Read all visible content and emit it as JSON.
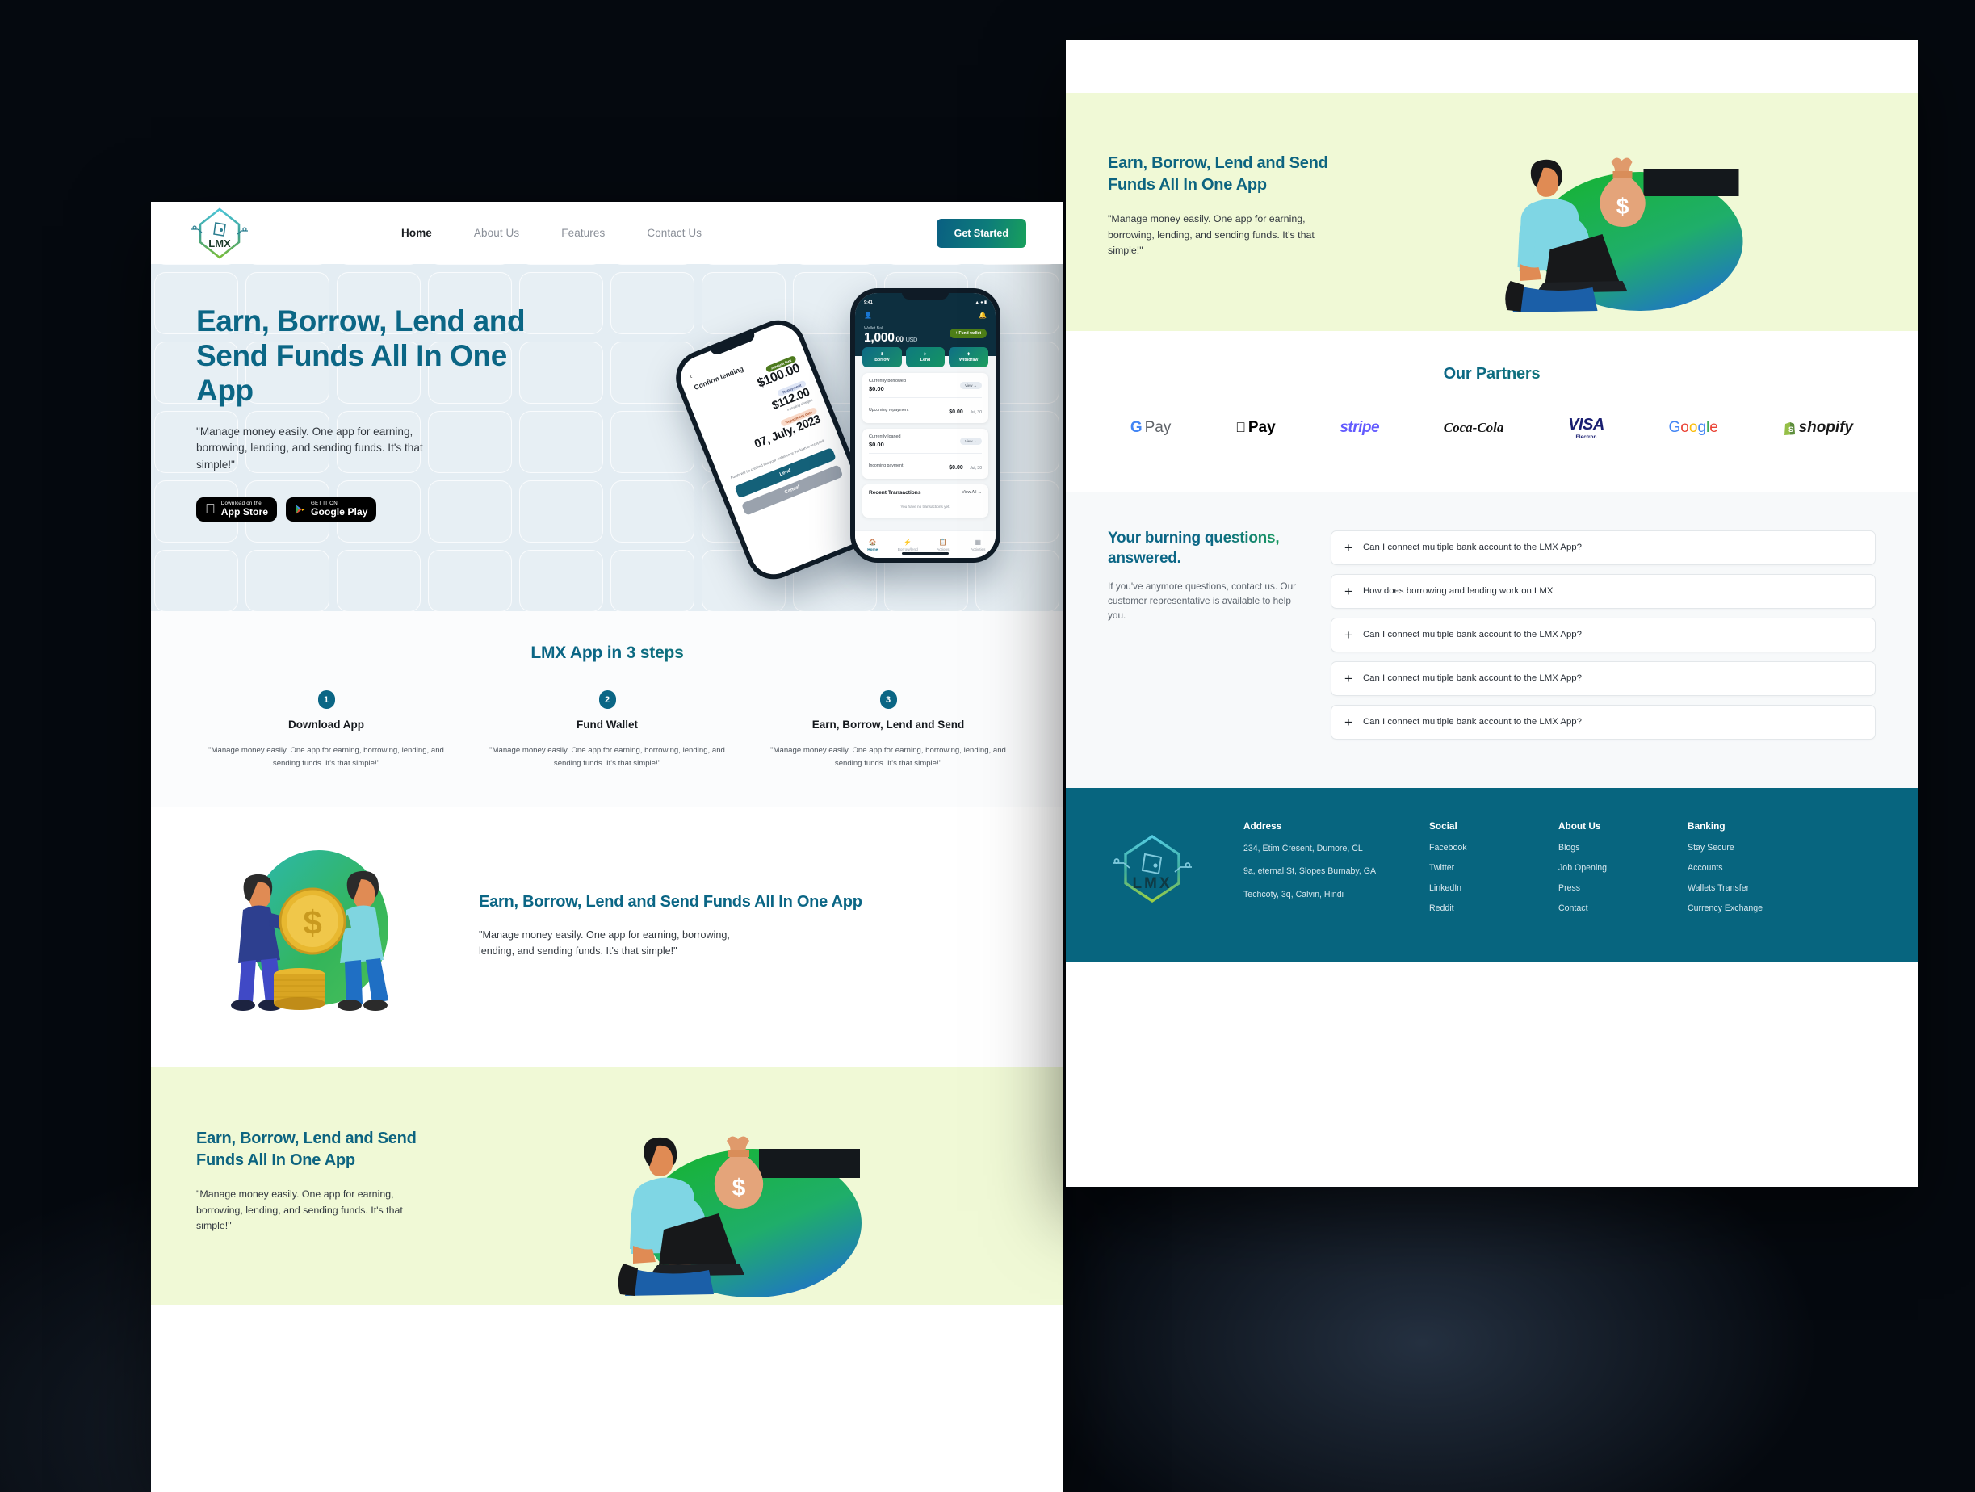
{
  "nav": {
    "logo_text": "LMX",
    "links": [
      {
        "label": "Home",
        "active": true
      },
      {
        "label": "About Us",
        "active": false
      },
      {
        "label": "Features",
        "active": false
      },
      {
        "label": "Contact Us",
        "active": false
      }
    ],
    "cta": "Get Started"
  },
  "hero": {
    "heading": "Earn, Borrow, Lend and Send Funds All In One App",
    "subtext": "\"Manage money easily. One app for earning, borrowing, lending, and sending funds. It's that simple!\"",
    "app_store": {
      "small": "Download on the",
      "big": "App Store"
    },
    "google_play": {
      "small": "GET IT ON",
      "big": "Google Play"
    }
  },
  "phone_back": {
    "title": "Confirm lending",
    "tag_amount": "Amount lent",
    "amount": "$100.00",
    "tag_repayment": "Repayment",
    "repayment": "$112.00",
    "repayment_note": "including charges",
    "tag_date": "Repayment date",
    "date": "07, July, 2023",
    "note": "Funds will be credited into your wallet once the loan is accepted",
    "btn_primary": "Lend",
    "btn_ghost": "Cancel"
  },
  "phone_front": {
    "time": "9:41",
    "wallet_label": "Wallet Bal",
    "balance_int": "1,000",
    "balance_dec": ".00",
    "currency": "USD",
    "fund_wallet": "Fund wallet",
    "actions": [
      "Borrow",
      "Lend",
      "Withdraw"
    ],
    "card1": {
      "label": "Currently borrowed",
      "value": "$0.00",
      "view": "View",
      "row_label": "Upcoming repayment",
      "row_value": "$0.00",
      "row_date": "Jul, 30"
    },
    "card2": {
      "label": "Currently loaned",
      "value": "$0.00",
      "view": "View",
      "row_label": "Incoming payment",
      "row_value": "$0.00",
      "row_date": "Jul, 30"
    },
    "transactions": {
      "title": "Recent Transactions",
      "view_all": "View All",
      "empty": "You have no transactions yet."
    },
    "tabs": [
      "Home",
      "Borrow/lend",
      "Actions",
      "Activities"
    ]
  },
  "steps": {
    "title": "LMX App in 3 steps",
    "items": [
      {
        "num": "1",
        "heading": "Download App",
        "body": "\"Manage money easily. One app for earning, borrowing, lending, and sending funds. It's that simple!\""
      },
      {
        "num": "2",
        "heading": "Fund Wallet",
        "body": "\"Manage money easily. One app for earning, borrowing, lending, and sending funds. It's that simple!\""
      },
      {
        "num": "3",
        "heading": "Earn, Borrow, Lend and Send",
        "body": "\"Manage money easily. One app for earning, borrowing, lending, and sending funds. It's that simple!\""
      }
    ]
  },
  "feature": {
    "heading": "Earn, Borrow, Lend and Send Funds All In One App",
    "body": "\"Manage money easily. One app for earning, borrowing, lending, and sending funds. It's that simple!\""
  },
  "promo_left": {
    "heading": "Earn, Borrow, Lend and Send Funds All In One App",
    "body": "\"Manage money easily. One app for earning, borrowing, lending, and sending funds. It's that simple!\""
  },
  "promo_right": {
    "heading": "Earn, Borrow, Lend and Send Funds All In One App",
    "body": "\"Manage money easily. One app for earning, borrowing, lending, and sending funds. It's that simple!\""
  },
  "partners": {
    "title": "Our Partners",
    "items": [
      {
        "name": "gpay-logo",
        "text": "Pay",
        "mark": "G"
      },
      {
        "name": "apple-pay-logo",
        "text": "Pay",
        "mark": ""
      },
      {
        "name": "stripe-logo",
        "text": "stripe",
        "mark": ""
      },
      {
        "name": "coca-cola-logo",
        "text": "Coca-Cola",
        "mark": ""
      },
      {
        "name": "visa-electron-logo",
        "text": "VISA",
        "mark": "Electron"
      },
      {
        "name": "google-logo",
        "text": "Google",
        "mark": ""
      },
      {
        "name": "shopify-logo",
        "text": "shopify",
        "mark": ""
      }
    ]
  },
  "faq": {
    "heading": "Your burning questions, answered.",
    "body": "If you've anymore questions, contact us. Our customer representative is available to help you.",
    "items": [
      {
        "q": "Can I connect multiple bank account to the LMX App?"
      },
      {
        "q": "How does borrowing and lending work on LMX"
      },
      {
        "q": "Can I connect multiple bank account to the LMX App?"
      },
      {
        "q": "Can I connect multiple bank account to the LMX App?"
      },
      {
        "q": "Can I connect multiple bank account to the LMX App?"
      }
    ],
    "expand_icon": "+"
  },
  "footer": {
    "logo_text": "LMX",
    "address": {
      "heading": "Address",
      "lines": [
        "234, Etim Cresent, Dumore, CL",
        "9a, eternal St, Slopes Burnaby, GA",
        "Techcoty, 3q, Calvin, Hindi"
      ]
    },
    "social": {
      "heading": "Social",
      "links": [
        "Facebook",
        "Twitter",
        "LinkedIn",
        "Reddit"
      ]
    },
    "about": {
      "heading": "About Us",
      "links": [
        "Blogs",
        "Job Opening",
        "Press",
        "Contact"
      ]
    },
    "banking": {
      "heading": "Banking",
      "links": [
        "Stay Secure",
        "Accounts",
        "Wallets Transfer",
        "Currency Exchange"
      ]
    }
  },
  "colors": {
    "brand_teal": "#0b6685",
    "brand_green": "#1faa55",
    "footer_bg": "#07657f",
    "hero_bg": "#e4edf3",
    "promo_bg": "#f0f9d6"
  }
}
